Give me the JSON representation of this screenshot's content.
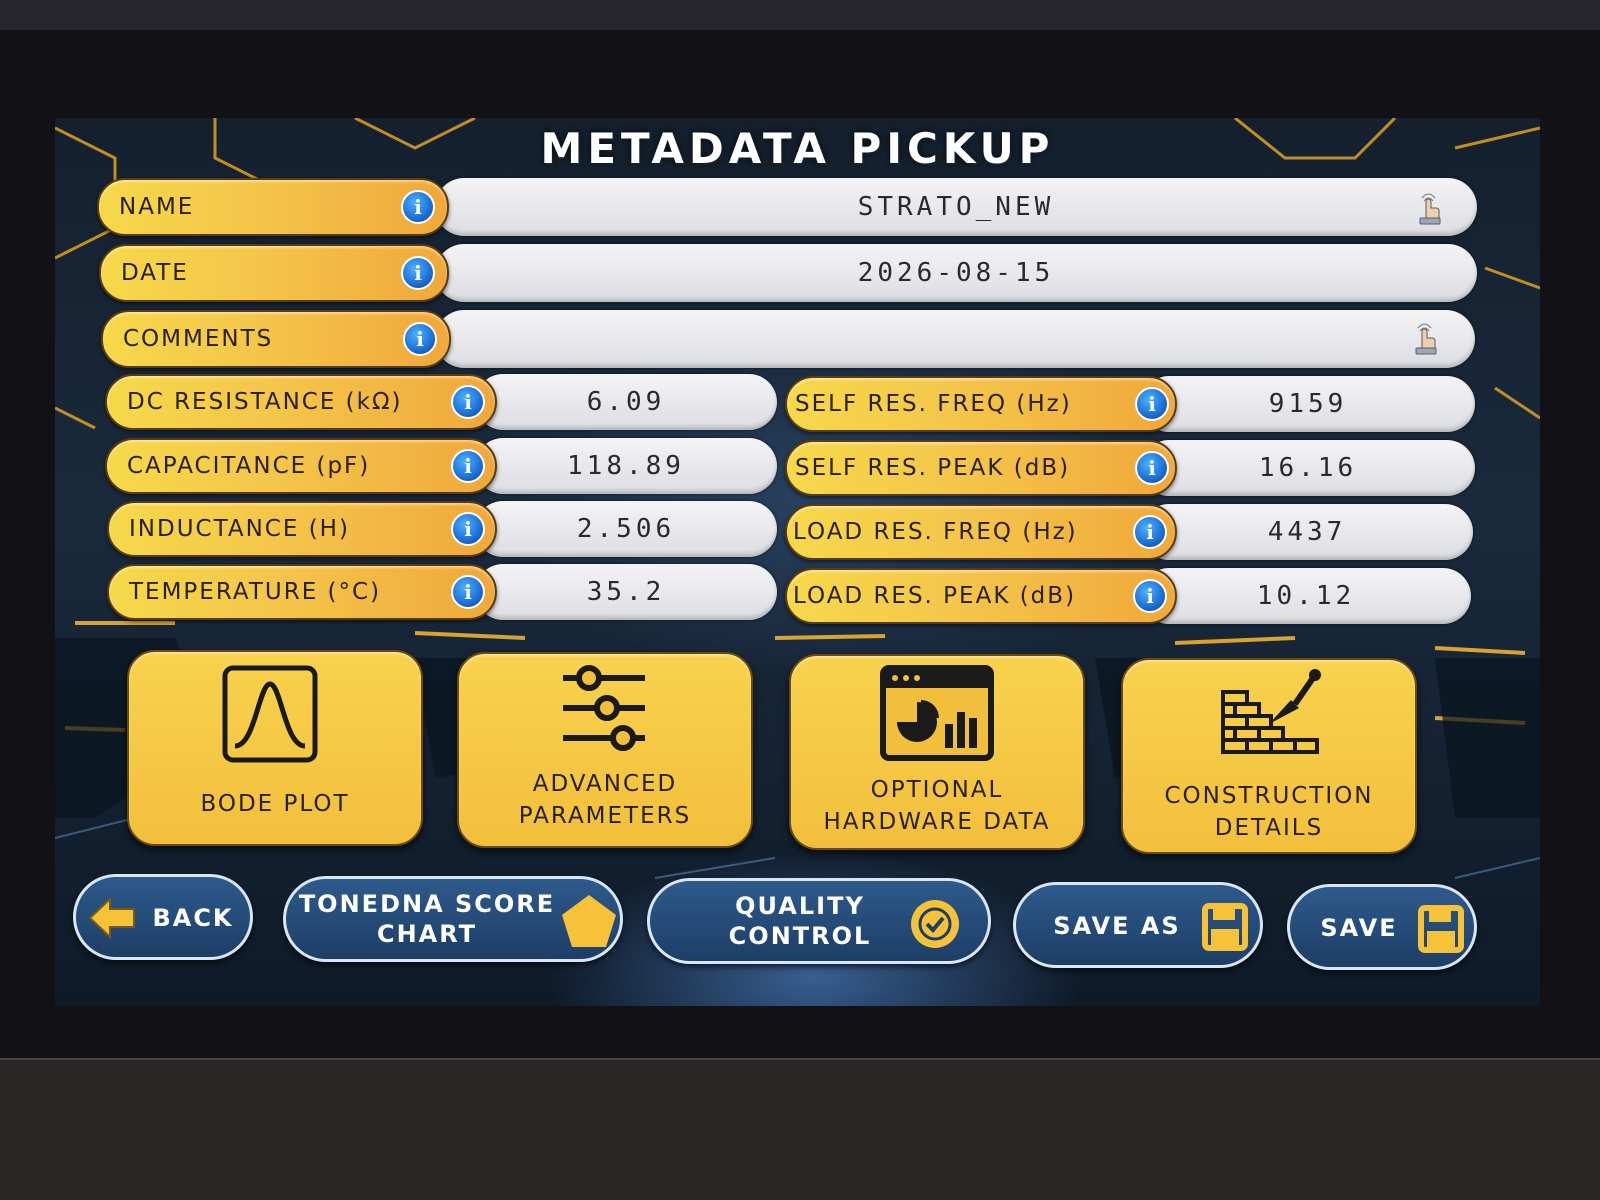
{
  "title": "METADATA PICKUP",
  "fields": {
    "name": {
      "label": "NAME",
      "value": "STRATO_NEW"
    },
    "date": {
      "label": "DATE",
      "value": "2026-08-15"
    },
    "comments": {
      "label": "COMMENTS",
      "value": ""
    }
  },
  "left_params": [
    {
      "label": "DC RESISTANCE (kΩ)",
      "value": "6.09"
    },
    {
      "label": "CAPACITANCE (pF)",
      "value": "118.89"
    },
    {
      "label": "INDUCTANCE (H)",
      "value": "2.506"
    },
    {
      "label": "TEMPERATURE (°C)",
      "value": "35.2"
    }
  ],
  "right_params": [
    {
      "label": "SELF RES. FREQ (Hz)",
      "value": "9159"
    },
    {
      "label": "SELF RES. PEAK (dB)",
      "value": "16.16"
    },
    {
      "label": "LOAD RES. FREQ (Hz)",
      "value": "4437"
    },
    {
      "label": "LOAD RES. PEAK (dB)",
      "value": "10.12"
    }
  ],
  "tiles": {
    "bode": {
      "line1": "BODE PLOT",
      "icon": "bell-curve-icon"
    },
    "advanced": {
      "line1": "ADVANCED",
      "line2": "PARAMETERS",
      "icon": "sliders-icon"
    },
    "hardware": {
      "line1": "OPTIONAL",
      "line2": "HARDWARE DATA",
      "icon": "dashboard-window-icon"
    },
    "construction": {
      "line1": "CONSTRUCTION",
      "line2": "DETAILS",
      "icon": "brick-wall-trowel-icon"
    }
  },
  "nav": {
    "back": "BACK",
    "score_line1": "TONEDNA SCORE",
    "score_line2": "CHART",
    "qc_line1": "QUALITY",
    "qc_line2": "CONTROL",
    "save_as": "SAVE AS",
    "save": "SAVE"
  },
  "colors": {
    "label_yellow": "#f6d94a",
    "label_orange": "#f0a83a",
    "nav_blue": "#1d3e66",
    "info_blue": "#1a6fd6"
  }
}
